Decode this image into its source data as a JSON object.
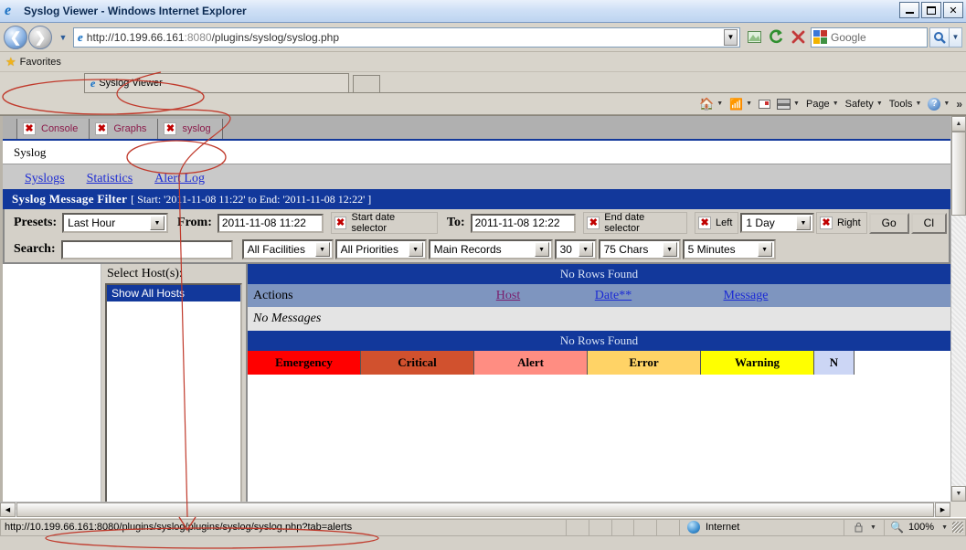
{
  "window": {
    "title": "Syslog Viewer - Windows Internet Explorer",
    "minimize_label": "Minimize",
    "maximize_label": "Maximize",
    "close_label": "Close"
  },
  "browser": {
    "back_label": "Back",
    "forward_label": "Forward",
    "recent_pages_label": "Recent Pages",
    "url": "http://10.199.66.161:8080/plugins/syslog/syslog.php",
    "url_host": "http://10.199.66.161",
    "url_port": ":8080",
    "url_path": "/plugins/syslog/syslog.php",
    "compat_view_label": "Compatibility View",
    "refresh_label": "Refresh",
    "stop_label": "Stop",
    "search_placeholder": "Google",
    "search_value": "",
    "search_button_label": "Search",
    "favorites_label": "Favorites",
    "tab_title": "Syslog Viewer",
    "new_tab_label": "New Tab"
  },
  "commandbar": {
    "items": [
      {
        "label": "Home",
        "icon": "home-icon",
        "caret": true
      },
      {
        "label": "Feeds",
        "icon": "feed-icon",
        "caret": true
      },
      {
        "label": "Read Mail",
        "icon": "mail-icon",
        "caret": false
      },
      {
        "label": "Print",
        "icon": "print-icon",
        "caret": true
      },
      {
        "label": "Page",
        "icon": "page-icon",
        "caret": true
      },
      {
        "label": "Safety",
        "icon": "safety-icon",
        "caret": true
      },
      {
        "label": "Tools",
        "icon": "tools-icon",
        "caret": true
      },
      {
        "label": "Help",
        "icon": "help-icon",
        "caret": true
      }
    ],
    "overflow": "»"
  },
  "plugin_tabs": [
    {
      "label": "Console",
      "close": "✖"
    },
    {
      "label": "Graphs",
      "close": "✖"
    },
    {
      "label": "syslog",
      "close": "✖"
    }
  ],
  "breadcrumb": "Syslog",
  "subtabs": [
    {
      "label": "Syslogs",
      "selected": false
    },
    {
      "label": "Statistics",
      "selected": false
    },
    {
      "label": "Alert Log",
      "selected": true
    }
  ],
  "filter": {
    "title": "Syslog Message Filter",
    "range": "[ Start: '2011-11-08 11:22' to End: '2011-11-08 12:22' ]",
    "presets_label": "Presets:",
    "presets_value": "Last Hour",
    "from_label": "From:",
    "from_value": "2011-11-08 11:22",
    "start_selector_label": "Start date selector",
    "to_label": "To:",
    "to_value": "2011-11-08 12:22",
    "end_selector_label": "End date selector",
    "left_label": "Left",
    "shift_value": "1 Day",
    "right_label": "Right",
    "go_label": "Go",
    "clear_label": "Cl",
    "search_label": "Search:",
    "search_value": "",
    "facilities_value": "All Facilities",
    "priorities_value": "All Priorities",
    "records_value": "Main Records",
    "rows_value": "30",
    "chars_value": "75 Chars",
    "refresh_value": "5 Minutes"
  },
  "hosts": {
    "label": "Select Host(s):",
    "options": [
      "Show All Hosts"
    ],
    "selected": "Show All Hosts"
  },
  "results": {
    "rows_found_top": "No Rows Found",
    "rows_found_bottom": "No Rows Found",
    "columns": [
      {
        "label": "Actions",
        "link": false
      },
      {
        "label": "Host",
        "link": true,
        "visited": true
      },
      {
        "label": "Date**",
        "link": true,
        "visited": false
      },
      {
        "label": "Message",
        "link": true,
        "visited": false
      }
    ],
    "empty_message": "No Messages"
  },
  "severities": [
    {
      "label": "Emergency",
      "color": "#FF0000",
      "width": 124
    },
    {
      "label": "Critical",
      "color": "#D1512E",
      "width": 124
    },
    {
      "label": "Alert",
      "color": "#FF8D82",
      "width": 124
    },
    {
      "label": "Error",
      "color": "#FFD366",
      "width": 124
    },
    {
      "label": "Warning",
      "color": "#FFFF00",
      "width": 124
    },
    {
      "label": "N",
      "color": "#CCD6F5",
      "width": 40
    }
  ],
  "statusbar": {
    "url": "http://10.199.66.161:8080/plugins/syslog/plugins/syslog/syslog.php?tab=alerts",
    "zone": "Internet",
    "zoom": "100%",
    "privacy_label": "Privacy Report"
  }
}
